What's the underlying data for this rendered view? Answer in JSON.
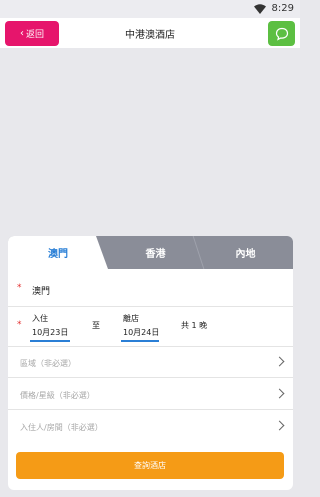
{
  "status_bar": {
    "time": "8:29",
    "wifi_icon": "wifi-icon"
  },
  "header": {
    "back_label": "返回",
    "title": "中港澳酒店",
    "chat_icon": "chat-bubble-icon"
  },
  "colors": {
    "back": "#e6156c",
    "chat": "#5cbf42",
    "accent": "#2a7fd6",
    "search": "#f59b16",
    "tabs_bg": "#8a8d98",
    "required": "#e32f2f"
  },
  "tabs": [
    {
      "label": "澳門",
      "active": true
    },
    {
      "label": "香港",
      "active": false
    },
    {
      "label": "內地",
      "active": false
    }
  ],
  "city": {
    "required_mark": "*",
    "value": "澳門"
  },
  "dates": {
    "required_mark": "*",
    "checkin_label": "入住",
    "checkin_value": "10月23日",
    "separator": "至",
    "checkout_label": "離店",
    "checkout_value": "10月24日",
    "nights": "共 1 晚"
  },
  "options": [
    {
      "label": "區域（非必選）"
    },
    {
      "label": "價格/星級（非必選）"
    },
    {
      "label": "入住人/房間（非必選）"
    }
  ],
  "search_label": "查詢酒店"
}
